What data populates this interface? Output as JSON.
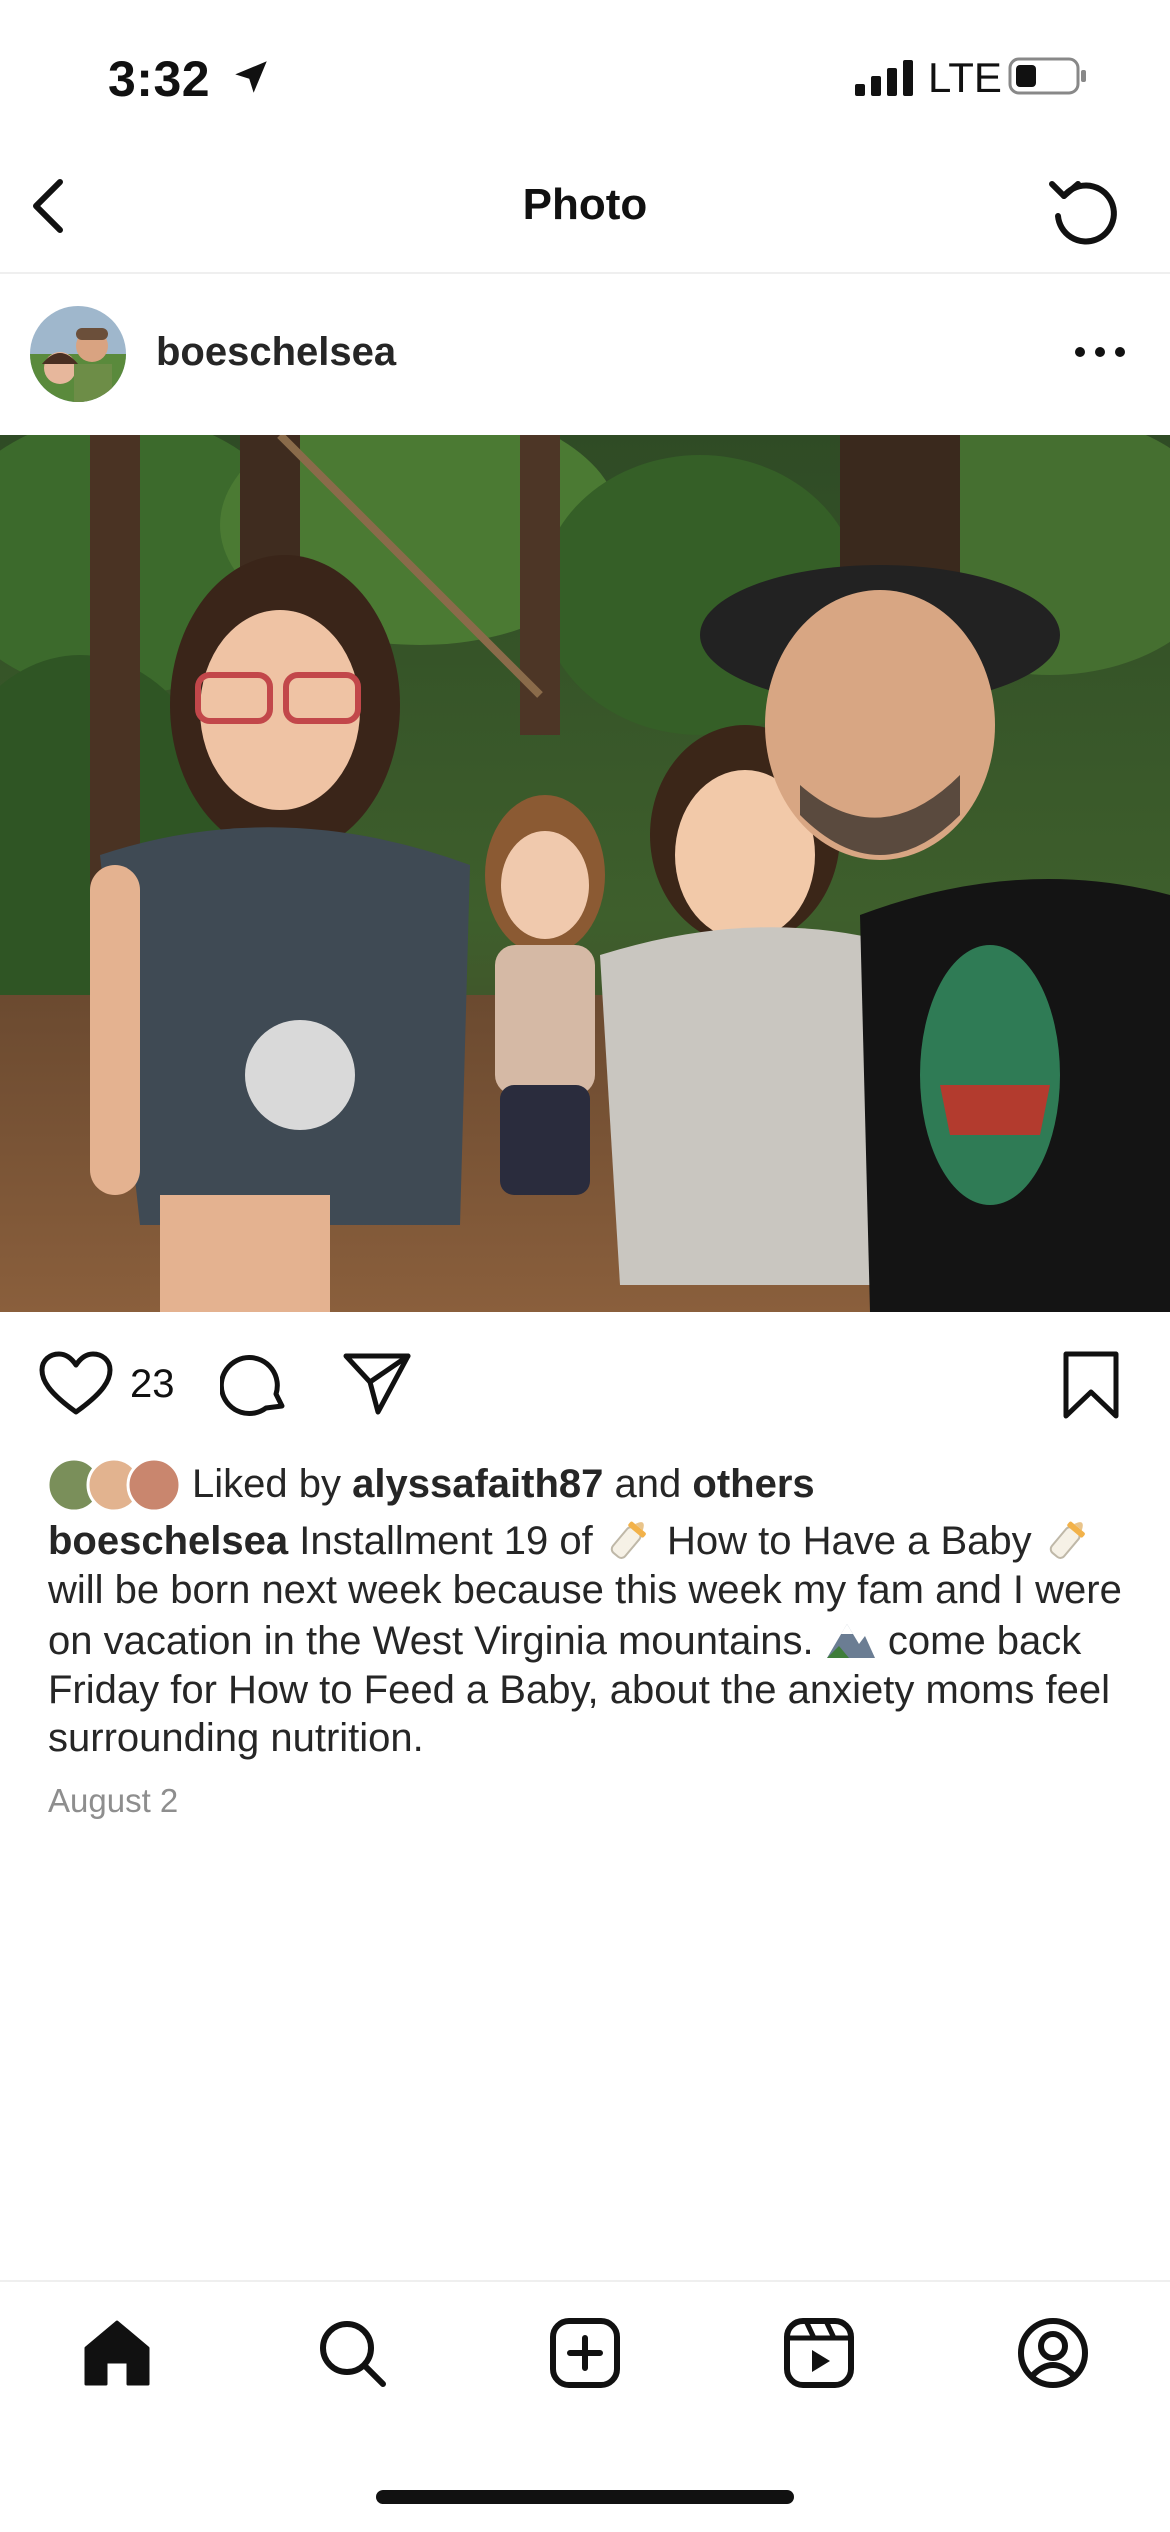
{
  "status_bar": {
    "time": "3:32",
    "network": "LTE",
    "icons": [
      "location-arrow-icon",
      "signal-bars-icon",
      "battery-icon"
    ]
  },
  "nav": {
    "title": "Photo",
    "back_icon": "chevron-left-icon",
    "refresh_icon": "refresh-icon"
  },
  "post": {
    "username": "boeschelsea",
    "like_count": "23",
    "liked_by_prefix": "Liked by",
    "liked_by_user": "alyssafaith87",
    "liked_by_and": "and",
    "liked_by_others": "others",
    "caption": {
      "username": "boeschelsea",
      "part1": "Installment 19 of",
      "part2": "How to Have a Baby",
      "part3": "will be born next week because this week my fam and I were on vacation in the West Virginia mountains.",
      "part4": "come back Friday for How to Feed a Baby, about the anxiety moms feel surrounding nutrition."
    },
    "date": "August 2"
  },
  "tab_bar": {
    "items": [
      "home-icon",
      "search-icon",
      "create-icon",
      "reels-icon",
      "profile-icon"
    ]
  },
  "colors": {
    "text": "#262626",
    "muted": "#8e8e8e",
    "divider": "#efefef"
  }
}
